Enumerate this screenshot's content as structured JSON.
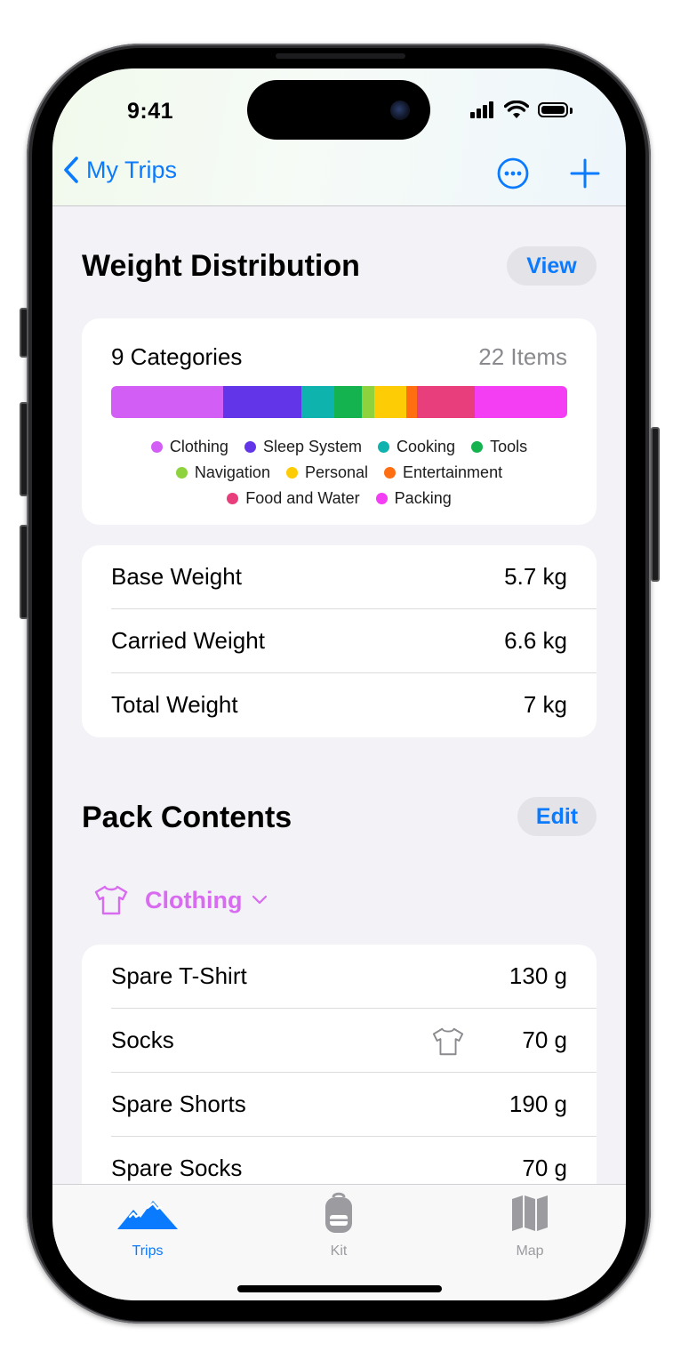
{
  "status": {
    "time": "9:41"
  },
  "nav": {
    "back_label": "My Trips"
  },
  "weight_distribution": {
    "title": "Weight Distribution",
    "view_label": "View",
    "categories_count": "9 Categories",
    "items_count": "22 Items",
    "segments": [
      {
        "name": "Clothing",
        "color": "#d35ef5",
        "share": 0.245
      },
      {
        "name": "Sleep System",
        "color": "#6236e8",
        "share": 0.172
      },
      {
        "name": "Cooking",
        "color": "#0fb3ad",
        "share": 0.072
      },
      {
        "name": "Tools",
        "color": "#14b350",
        "share": 0.06
      },
      {
        "name": "Navigation",
        "color": "#8ed23e",
        "share": 0.028
      },
      {
        "name": "Personal",
        "color": "#fecc05",
        "share": 0.07
      },
      {
        "name": "Entertainment",
        "color": "#ff6e10",
        "share": 0.023
      },
      {
        "name": "Food and Water",
        "color": "#e83e7c",
        "share": 0.128
      },
      {
        "name": "Packing",
        "color": "#f33ef3",
        "share": 0.202
      }
    ],
    "legend": [
      {
        "label": "Clothing",
        "color": "#d35ef5"
      },
      {
        "label": "Sleep System",
        "color": "#6236e8"
      },
      {
        "label": "Cooking",
        "color": "#0fb3ad"
      },
      {
        "label": "Tools",
        "color": "#14b350"
      },
      {
        "label": "Navigation",
        "color": "#8ed23e"
      },
      {
        "label": "Personal",
        "color": "#fecc05"
      },
      {
        "label": "Entertainment",
        "color": "#ff6e10"
      },
      {
        "label": "Food and Water",
        "color": "#e83e7c"
      },
      {
        "label": "Packing",
        "color": "#f33ef3"
      }
    ]
  },
  "weights": [
    {
      "label": "Base Weight",
      "value": "5.7 kg"
    },
    {
      "label": "Carried Weight",
      "value": "6.6 kg"
    },
    {
      "label": "Total Weight",
      "value": "7 kg"
    }
  ],
  "pack_contents": {
    "title": "Pack Contents",
    "edit_label": "Edit",
    "category": {
      "label": "Clothing",
      "color": "#d86bf0",
      "icon": "tshirt-icon"
    },
    "items": [
      {
        "name": "Spare T-Shirt",
        "weight": "130 g",
        "worn": false
      },
      {
        "name": "Socks",
        "weight": "70 g",
        "worn": true
      },
      {
        "name": "Spare Shorts",
        "weight": "190 g",
        "worn": false
      },
      {
        "name": "Spare Socks",
        "weight": "70 g",
        "worn": false
      }
    ]
  },
  "tabbar": {
    "tabs": [
      {
        "label": "Trips",
        "icon": "mountains-icon",
        "active": true
      },
      {
        "label": "Kit",
        "icon": "backpack-icon",
        "active": false
      },
      {
        "label": "Map",
        "icon": "map-icon",
        "active": false
      }
    ],
    "active_color": "#0a7aff",
    "inactive_color": "#9b9ba0"
  }
}
